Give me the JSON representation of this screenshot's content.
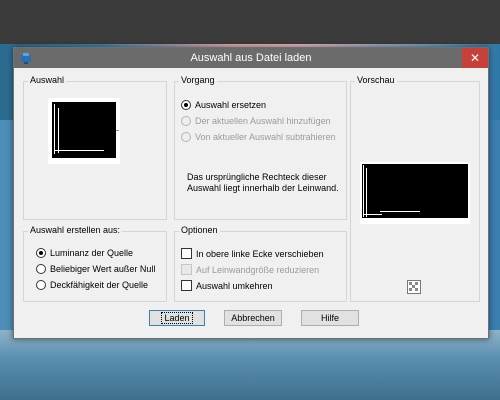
{
  "dialog": {
    "title": "Auswahl aus Datei laden",
    "close_label": "✕"
  },
  "groups": {
    "auswahl_title": "Auswahl",
    "vorgang_title": "Vorgang",
    "vorschau_title": "Vorschau",
    "erstellen_title": "Auswahl erstellen aus:",
    "optionen_title": "Optionen"
  },
  "vorgang": {
    "options": [
      {
        "label": "Auswahl ersetzen",
        "selected": true,
        "enabled": true
      },
      {
        "label": "Der aktuellen Auswahl hinzufügen",
        "selected": false,
        "enabled": false
      },
      {
        "label": "Von aktueller Auswahl subtrahieren",
        "selected": false,
        "enabled": false
      }
    ],
    "info": "Das ursprüngliche Rechteck dieser Auswahl liegt innerhalb der Leinwand."
  },
  "erstellen": {
    "options": [
      {
        "label": "Luminanz der Quelle",
        "selected": true
      },
      {
        "label": "Beliebiger Wert außer Null",
        "selected": false
      },
      {
        "label": "Deckfähigkeit der Quelle",
        "selected": false
      }
    ]
  },
  "optionen": {
    "items": [
      {
        "label": "In obere linke Ecke verschieben",
        "checked": false,
        "enabled": true
      },
      {
        "label": "Auf Leinwandgröße reduzieren",
        "checked": false,
        "enabled": false
      },
      {
        "label": "Auswahl umkehren",
        "checked": false,
        "enabled": true
      }
    ]
  },
  "buttons": {
    "load": "Laden",
    "cancel": "Abbrechen",
    "help": "Hilfe"
  },
  "icons": {
    "app": "app-icon",
    "checker": "transparency-checker-icon"
  }
}
